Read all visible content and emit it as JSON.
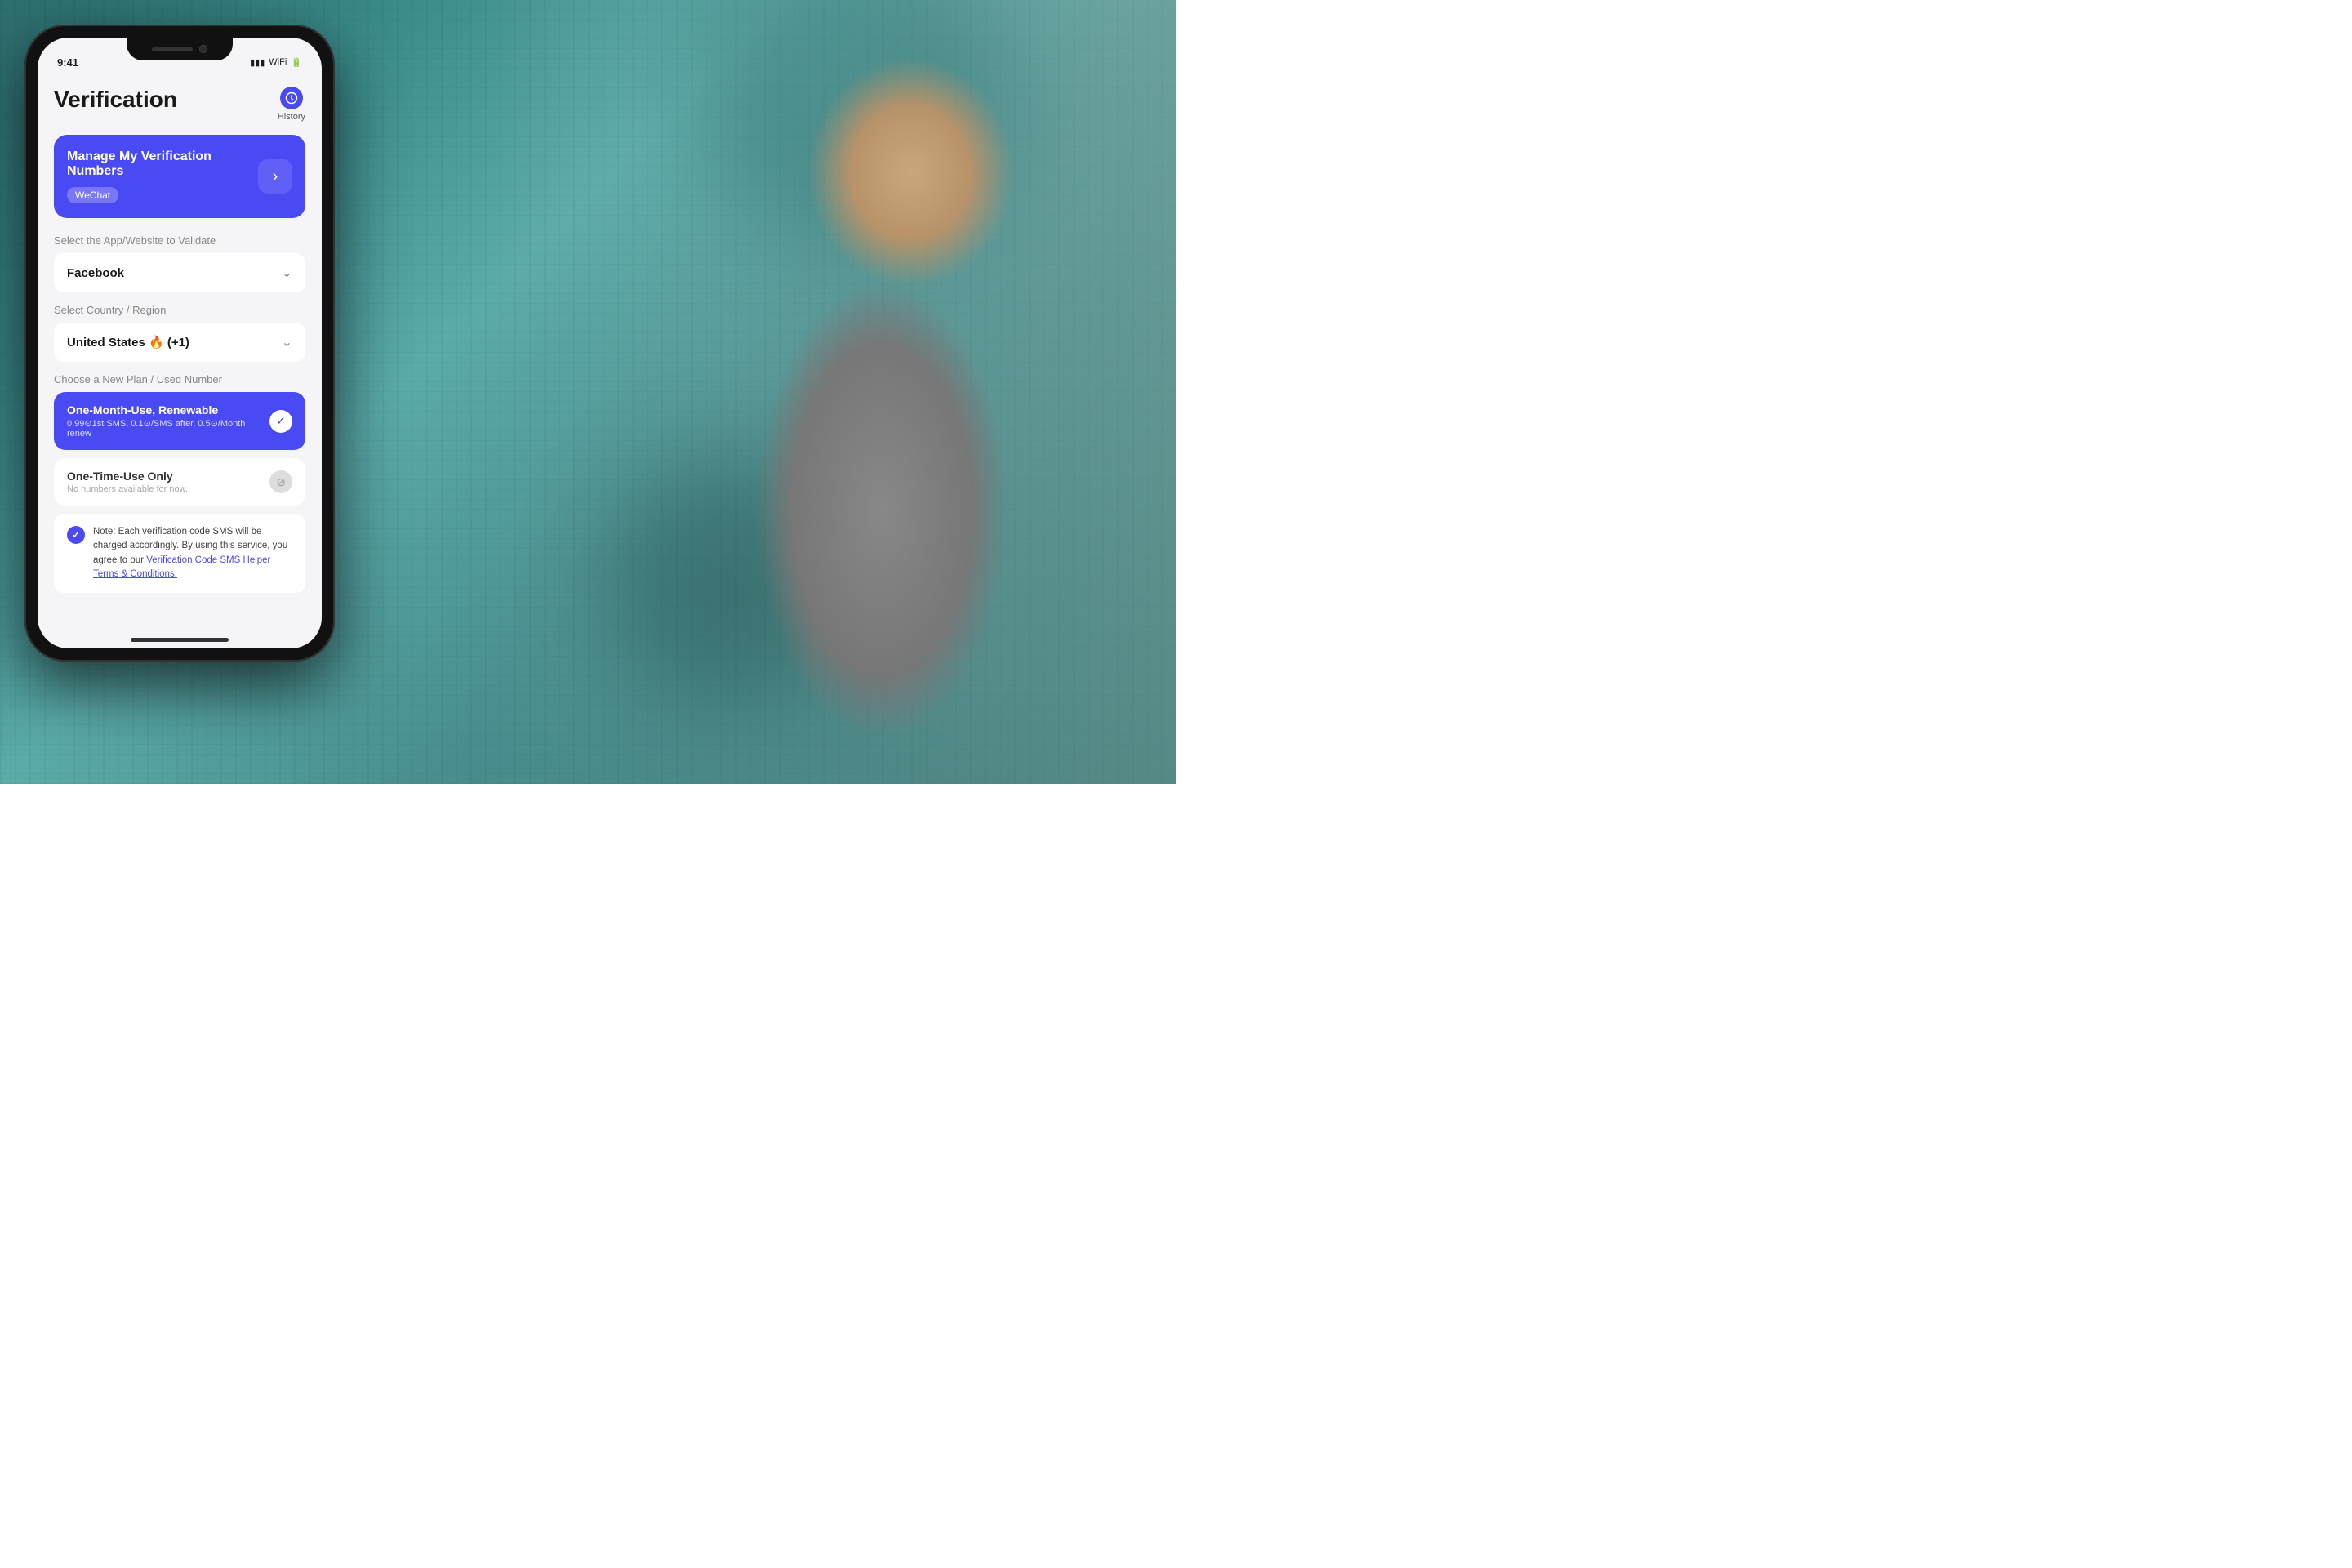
{
  "background": {
    "alt": "Woman on phone in urban setting"
  },
  "phone": {
    "screen_title": "Verification",
    "history_label": "History",
    "status_time": "9:41",
    "manage_card": {
      "title": "Manage My Verification Numbers",
      "badge": "WeChat",
      "arrow_icon": "→"
    },
    "app_section_label": "Select the App/Website to Validate",
    "app_dropdown_value": "Facebook",
    "country_section_label": "Select Country / Region",
    "country_dropdown_value": "United States 🔥 (+1)",
    "plan_section_label": "Choose a New Plan / Used Number",
    "plans": [
      {
        "id": "one-month",
        "name": "One-Month-Use, Renewable",
        "desc": "0.99⊙1st SMS, 0.1⊙/SMS after, 0.5⊙/Month renew",
        "selected": true
      },
      {
        "id": "one-time",
        "name": "One-Time-Use Only",
        "desc": "No numbers available for now.",
        "selected": false
      }
    ],
    "note": {
      "text": "Note: Each verification code SMS will be charged accordingly. By using this service, you agree to our",
      "link_text": "Verification Code SMS Helper Terms & Conditions."
    }
  }
}
